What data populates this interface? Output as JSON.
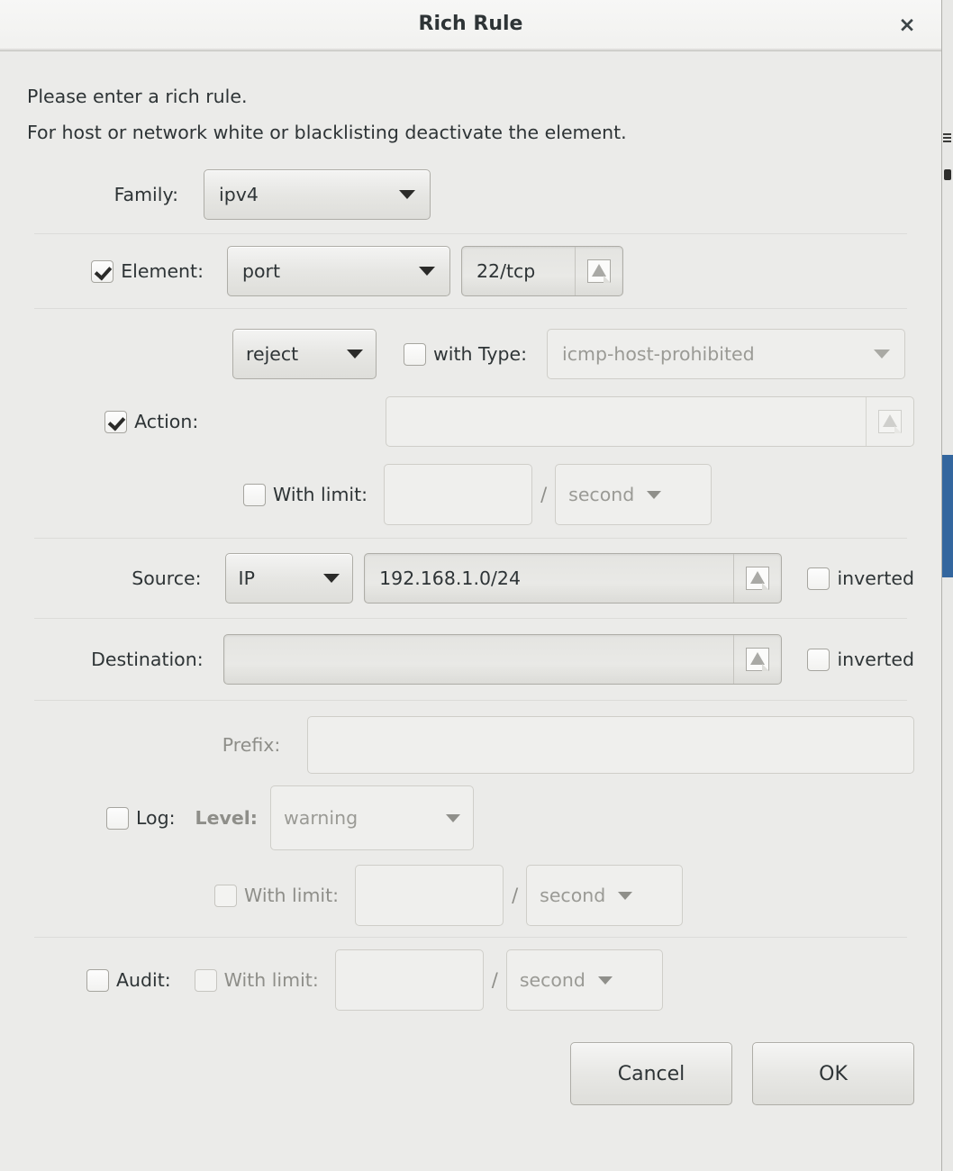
{
  "window": {
    "title": "Rich Rule",
    "close_label": "×"
  },
  "intro": {
    "line1": "Please enter a rich rule.",
    "line2": "For host or network white or blacklisting deactivate the element."
  },
  "family": {
    "label": "Family:",
    "value": "ipv4"
  },
  "element": {
    "label": "Element:",
    "checked": true,
    "type_value": "port",
    "entry_value": "22/tcp"
  },
  "action": {
    "label": "Action:",
    "checked": true,
    "type_value": "reject",
    "with_type_label": "with Type:",
    "with_type_checked": false,
    "icmp_type_value": "icmp-host-prohibited",
    "entry_value": "",
    "with_limit_label": "With limit:",
    "with_limit_checked": false,
    "limit_value": "",
    "limit_separator": "/",
    "limit_unit": "second"
  },
  "source": {
    "label": "Source:",
    "kind_value": "IP",
    "entry_value": "192.168.1.0/24",
    "inverted_label": "inverted",
    "inverted_checked": false
  },
  "destination": {
    "label": "Destination:",
    "entry_value": "",
    "inverted_label": "inverted",
    "inverted_checked": false
  },
  "log": {
    "label": "Log:",
    "checked": false,
    "prefix_label": "Prefix:",
    "prefix_value": "",
    "level_label": "Level:",
    "level_value": "warning",
    "with_limit_label": "With limit:",
    "with_limit_checked": false,
    "limit_value": "",
    "limit_separator": "/",
    "limit_unit": "second"
  },
  "audit": {
    "label": "Audit:",
    "checked": false,
    "with_limit_label": "With limit:",
    "with_limit_checked": false,
    "limit_value": "",
    "limit_separator": "/",
    "limit_unit": "second"
  },
  "buttons": {
    "cancel": "Cancel",
    "ok": "OK"
  },
  "colors": {
    "dialog_bg": "#ebebe9",
    "titlebar_bg": "#f3f3f1",
    "text": "#2e3436",
    "disabled_text": "#9a9a95",
    "selection_blue": "#33669e"
  },
  "icons": {
    "entry_warning": "warning-icon",
    "close": "close-icon",
    "dropdown": "chevron-down-icon"
  }
}
